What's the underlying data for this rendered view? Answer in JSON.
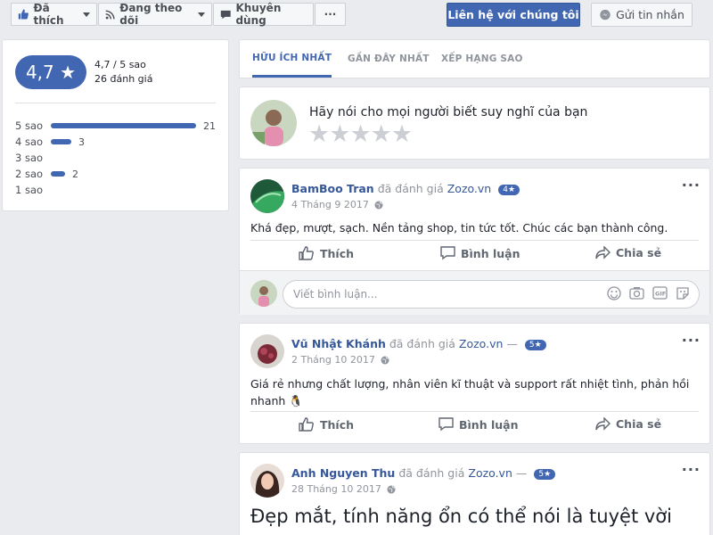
{
  "topbar": {
    "liked_label": "Đã thích",
    "following_label": "Đang theo dõi",
    "recommend_label": "Khuyên dùng",
    "more_label": "···",
    "contact_label": "Liên hệ với chúng tôi",
    "message_label": "Gửi tin nhắn"
  },
  "rating_summary": {
    "score_display": "4,7 ★",
    "score_text": "4,7 / 5 sao",
    "count_text": "26 đánh giá",
    "distribution": [
      {
        "label": "5 sao",
        "count": 21,
        "count_text": "21"
      },
      {
        "label": "4 sao",
        "count": 3,
        "count_text": "3"
      },
      {
        "label": "3 sao",
        "count": 0,
        "count_text": ""
      },
      {
        "label": "2 sao",
        "count": 2,
        "count_text": "2"
      },
      {
        "label": "1 sao",
        "count": 0,
        "count_text": ""
      }
    ],
    "max_count": 21
  },
  "tabs": [
    {
      "label": "HỮU ÍCH NHẤT",
      "active": true
    },
    {
      "label": "GẦN ĐÂY NHẤT",
      "active": false
    },
    {
      "label": "XẾP HẠNG SAO",
      "active": false
    }
  ],
  "compose": {
    "prompt": "Hãy nói cho mọi người biết suy nghĩ của bạn",
    "stars": "★★★★★"
  },
  "reviews": [
    {
      "author": "BamBoo Tran",
      "verb": "đã đánh giá",
      "page": "Zozo.vn",
      "separator": "",
      "rating": "4★",
      "date": "4 Tháng 9 2017",
      "text": "Khá đẹp, mượt, sạch. Nền tảng shop, tin tức tốt. Chúc các bạn thành công."
    },
    {
      "author": "Vũ Nhật Khánh",
      "verb": "đã đánh giá",
      "page": "Zozo.vn",
      "separator": "—",
      "rating": "5★",
      "date": "2 Tháng 10 2017",
      "text_line1": "Giá rẻ nhưng chất lượng, nhân viên kĩ thuật và support rất nhiệt tình, phản hồi",
      "text_line2": "nhanh 🐧"
    },
    {
      "author": "Anh Nguyen Thu",
      "verb": "đã đánh giá",
      "page": "Zozo.vn",
      "separator": "—",
      "rating": "5★",
      "date": "28 Tháng 10 2017",
      "text": "Đẹp mắt, tính năng ổn có thể nói là tuyệt vời"
    }
  ],
  "post_actions": {
    "like_label": "Thích",
    "comment_label": "Bình luận",
    "share_label": "Chia sẻ"
  },
  "comment": {
    "placeholder": "Viết bình luận..."
  },
  "colors": {
    "accent": "#4267b2",
    "link": "#365899",
    "background": "#e9ebee"
  },
  "icons": [
    "thumbs-up-icon",
    "rss-icon",
    "recommend-icon",
    "messenger-icon",
    "globe-icon",
    "share-icon",
    "comment-icon",
    "emoji-icon",
    "camera-icon",
    "gif-icon",
    "sticker-icon"
  ]
}
